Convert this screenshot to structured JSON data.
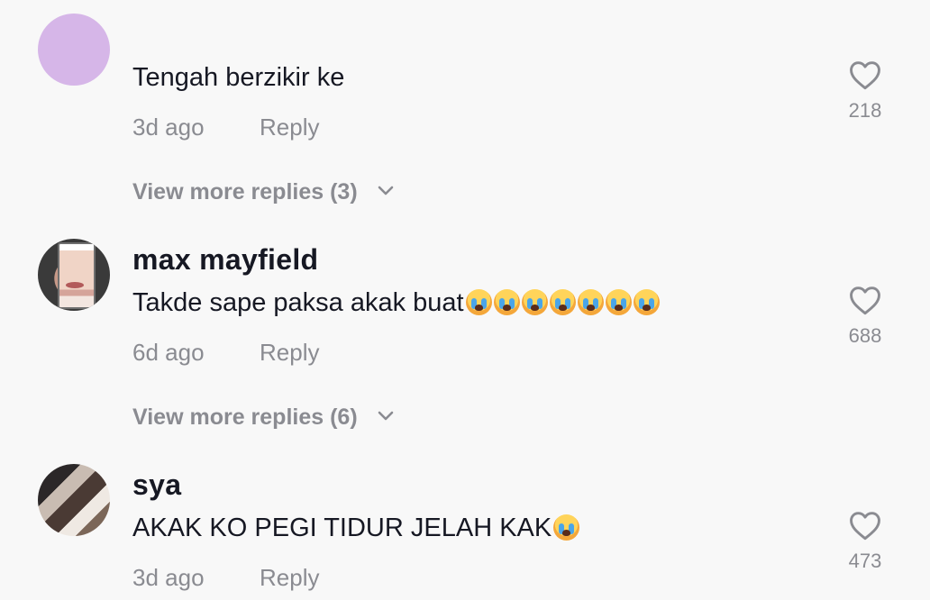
{
  "comments": [
    {
      "username": "",
      "text": "Tengah berzikir ke",
      "emoji_count": 0,
      "time": "3d ago",
      "reply_label": "Reply",
      "like_count": "218",
      "view_more": "View more replies (3)"
    },
    {
      "username": "max mayfield",
      "text": "Takde sape paksa akak buat",
      "emoji_count": 7,
      "emoji": "loudly-crying-face",
      "time": "6d ago",
      "reply_label": "Reply",
      "like_count": "688",
      "view_more": "View more replies (6)"
    },
    {
      "username": "sya",
      "text": "AKAK KO PEGI TIDUR JELAH KAK",
      "emoji_count": 1,
      "emoji": "loudly-crying-face",
      "time": "3d ago",
      "reply_label": "Reply",
      "like_count": "473"
    }
  ],
  "icons": {
    "like": "heart-outline-icon",
    "expand": "chevron-down-icon"
  },
  "colors": {
    "background": "#f8f8f8",
    "primary_text": "#161823",
    "secondary_text": "#8a8b91",
    "avatar_placeholder": "#d6b6e8"
  }
}
